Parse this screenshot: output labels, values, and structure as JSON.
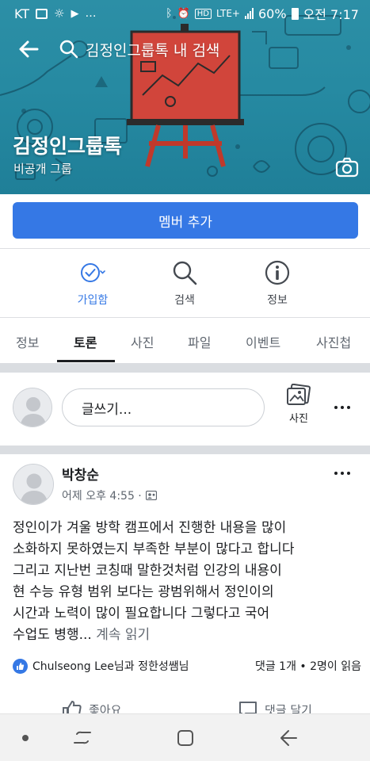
{
  "status_bar": {
    "carrier": "KT",
    "network": "LTE+",
    "battery": "60%",
    "time": "오전 7:17"
  },
  "header": {
    "search_placeholder": "김정인그룹톡 내 검색",
    "group_name": "김정인그룹톡",
    "privacy": "비공개 그룹"
  },
  "add_member_label": "멤버 추가",
  "actions": [
    {
      "label": "가입함",
      "icon": "check-circle-icon"
    },
    {
      "label": "검색",
      "icon": "search-icon"
    },
    {
      "label": "정보",
      "icon": "info-icon"
    }
  ],
  "tabs": [
    "정보",
    "토론",
    "사진",
    "파일",
    "이벤트",
    "사진첩"
  ],
  "active_tab": "토론",
  "composer": {
    "placeholder": "글쓰기...",
    "photo_label": "사진"
  },
  "post": {
    "author": "박창순",
    "time": "어제 오후 4:55 ·",
    "text_lines": [
      "정인이가  겨울 방학 캠프에서 진행한  내용을   많이",
      "소화하지 못하였는지  부족한 부분이 많다고 합니다",
      "그리고 지난번  코칭때  말한것처럼 인강의 내용이",
      "현  수능 유형 범위 보다는 광범위해서  정인이의",
      "시간과 노력이 많이 필요합니다  그렇다고 국어",
      "수업도 병행..."
    ],
    "see_more": "계속 읽기",
    "likers": "Chulseong Lee님과 정한성쌤님",
    "counts": "댓글 1개 • 2명이 읽음",
    "like_label": "좋아요",
    "comment_label": "댓글 달기"
  },
  "colors": {
    "accent": "#3578e5",
    "cover": "#268aa2",
    "easel": "#c0392b"
  }
}
